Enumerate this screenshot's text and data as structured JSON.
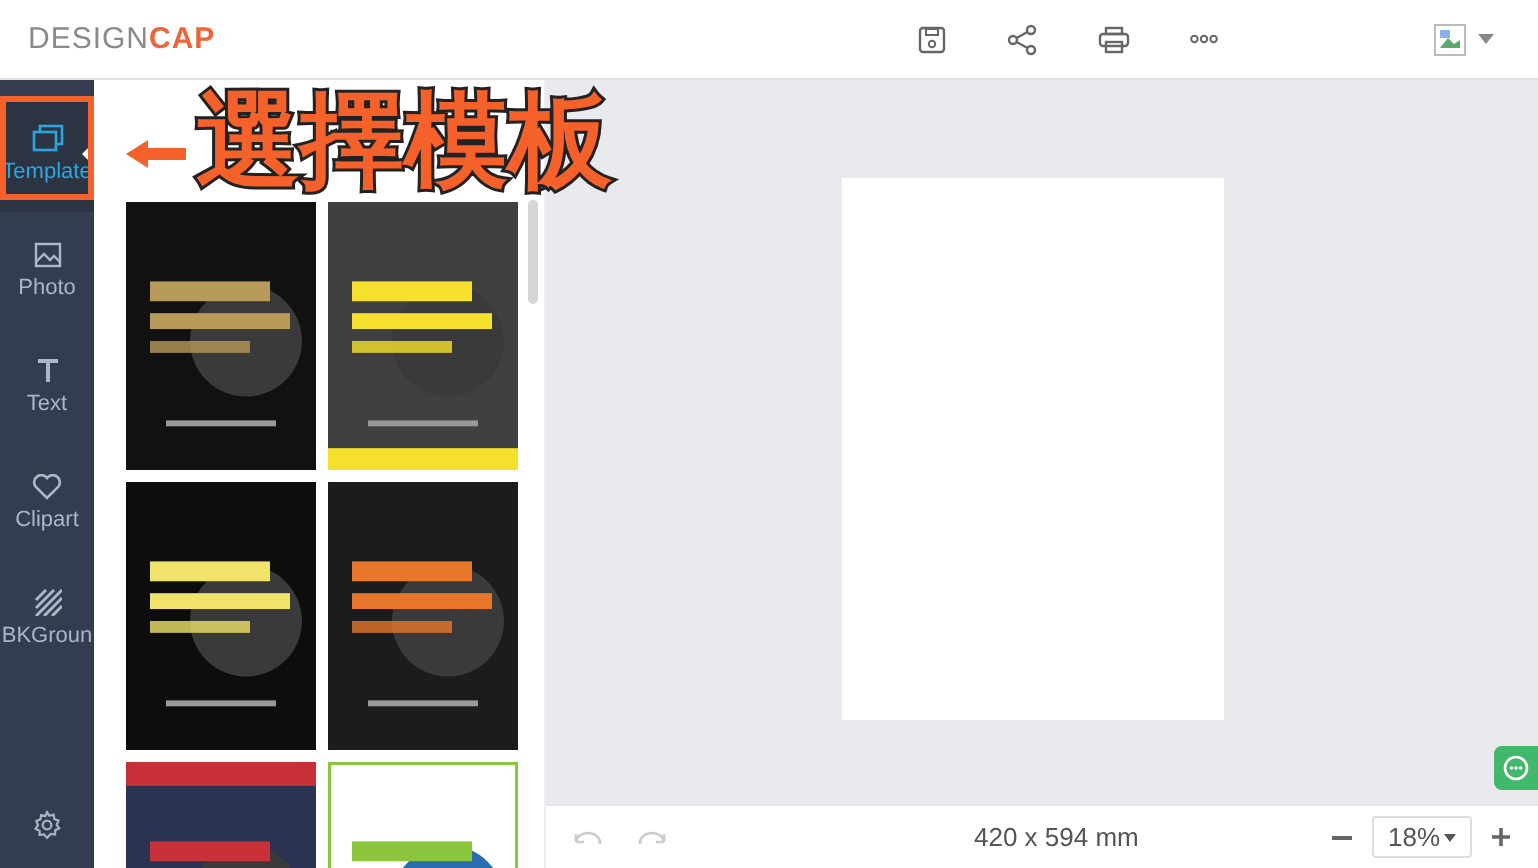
{
  "header": {
    "logo_left": "DESIGN",
    "logo_right": "CAP"
  },
  "sidebar": {
    "items": [
      {
        "label": "Template",
        "selected": true
      },
      {
        "label": "Photo",
        "selected": false
      },
      {
        "label": "Text",
        "selected": false
      },
      {
        "label": "Clipart",
        "selected": false
      },
      {
        "label": "BKGroun",
        "selected": false
      }
    ]
  },
  "status_bar": {
    "size": "420 x 594 mm",
    "zoom": "18%"
  },
  "annotation": {
    "text": "選擇模板"
  }
}
